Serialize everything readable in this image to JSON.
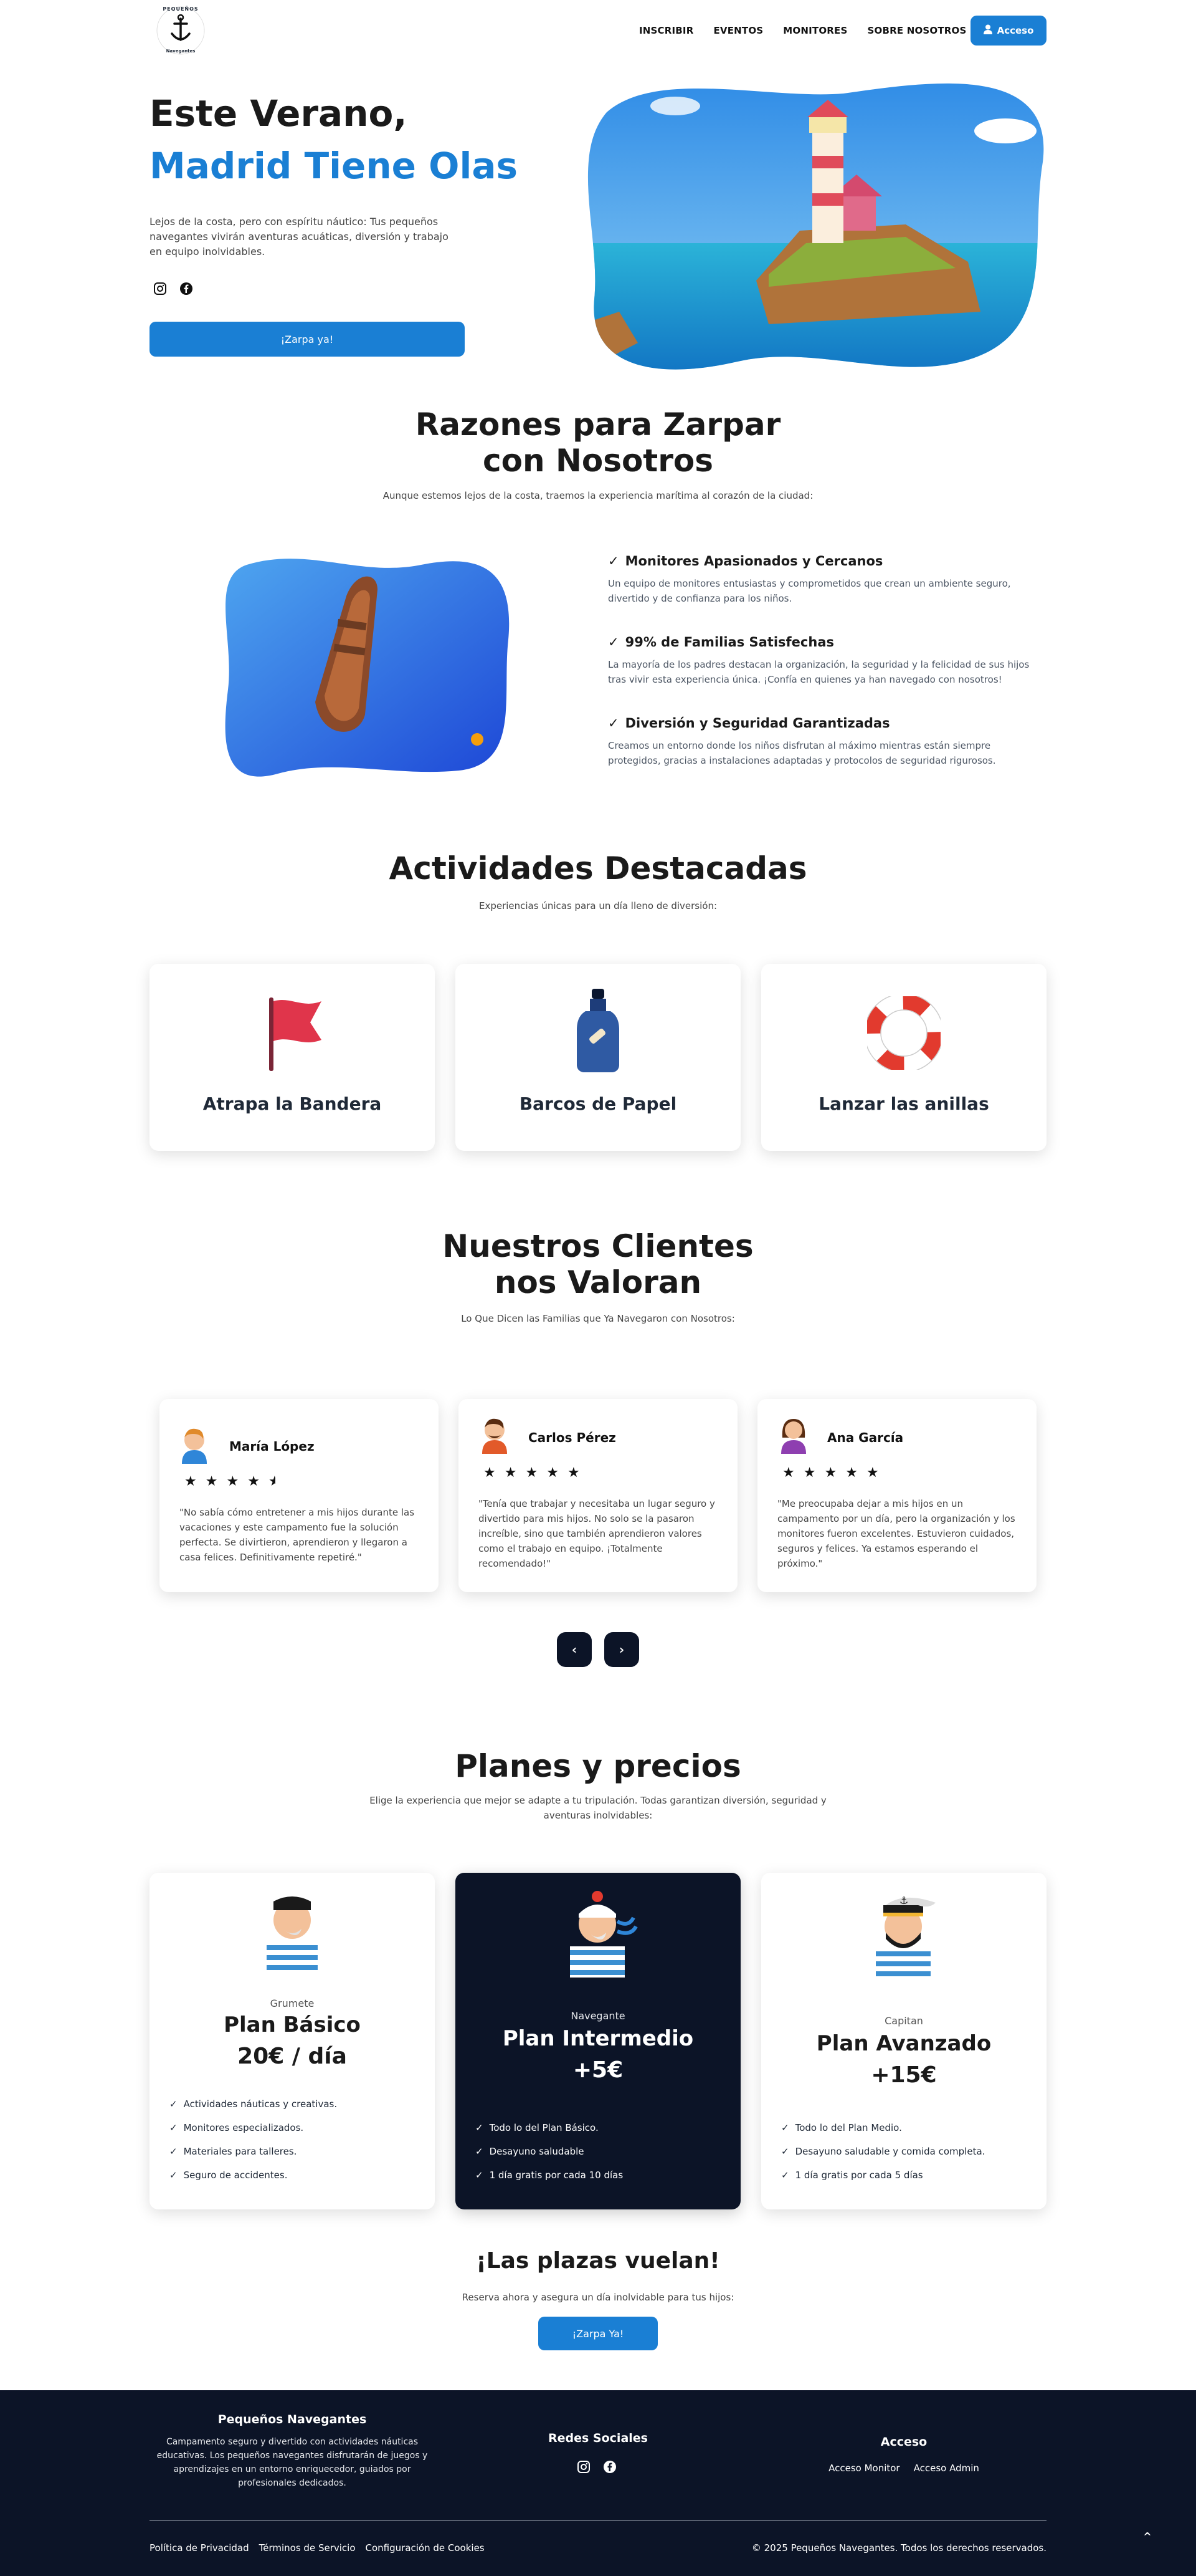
{
  "header": {
    "logo_text_top": "PEQUEÑOS",
    "logo_text_bottom": "Navegantes",
    "nav": [
      "INSCRIBIR",
      "EVENTOS",
      "MONITORES",
      "SOBRE NOSOTROS"
    ],
    "login_label": "Acceso"
  },
  "hero": {
    "title_line1": "Este Verano,",
    "title_line2": "Madrid Tiene Olas",
    "description": "Lejos de la costa, pero con espíritu náutico: Tus pequeños navegantes vivirán aventuras acuáticas, diversión y trabajo en equipo inolvidables.",
    "cta": "¡Zarpa ya!"
  },
  "reasons": {
    "title": "Razones para Zarpar con Nosotros",
    "subtitle": "Aunque estemos lejos de la costa, traemos la experiencia marítima al corazón de la ciudad:",
    "items": [
      {
        "title": "Monitores Apasionados y Cercanos",
        "text": "Un equipo de monitores entusiastas y comprometidos que crean un ambiente seguro, divertido y de confianza para los niños."
      },
      {
        "title": "99% de Familias Satisfechas",
        "text": "La mayoría de los padres destacan la organización, la seguridad y la felicidad de sus hijos tras vivir esta experiencia única. ¡Confía en quienes ya han navegado con nosotros!"
      },
      {
        "title": "Diversión y Seguridad Garantizadas",
        "text": "Creamos un entorno donde los niños disfrutan al máximo mientras están siempre protegidos, gracias a instalaciones adaptadas y protocolos de seguridad rigurosos."
      }
    ]
  },
  "activities": {
    "title": "Actividades Destacadas",
    "subtitle": "Experiencias únicas para un día lleno de diversión:",
    "items": [
      "Atrapa la Bandera",
      "Barcos de Papel",
      "Lanzar las anillas"
    ]
  },
  "reviews": {
    "title": "Nuestros Clientes nos Valoran",
    "subtitle": "Lo Que Dicen las Familias que Ya Navegaron con Nosotros:",
    "items": [
      {
        "name": "María López",
        "rating": 4.5,
        "text": "\"No sabía cómo entretener a mis hijos durante las vacaciones y este campamento fue la solución perfecta. Se divirtieron, aprendieron y llegaron a casa felices. Definitivamente repetiré.\""
      },
      {
        "name": "Carlos Pérez",
        "rating": 5,
        "text": "\"Tenía que trabajar y necesitaba un lugar seguro y divertido para mis hijos. No solo se la pasaron increíble, sino que también aprendieron valores como el trabajo en equipo. ¡Totalmente recomendado!\""
      },
      {
        "name": "Ana García",
        "rating": 5,
        "text": "\"Me preocupaba dejar a mis hijos en un campamento por un día, pero la organización y los monitores fueron excelentes. Estuvieron cuidados, seguros y felices. Ya estamos esperando el próximo.\""
      }
    ],
    "prev": "‹",
    "next": "›"
  },
  "plans": {
    "title": "Planes y precios",
    "subtitle": "Elige la experiencia que mejor se adapte a tu tripulación. Todas garantizan diversión, seguridad y aventuras inolvidables:",
    "items": [
      {
        "rank": "Grumete",
        "name": "Plan Básico",
        "price": "20€ / día",
        "features": [
          "Actividades náuticas y creativas.",
          "Monitores especializados.",
          "Materiales para talleres.",
          "Seguro de accidentes."
        ]
      },
      {
        "rank": "Navegante",
        "name": "Plan Intermedio",
        "price": "+5€",
        "features": [
          "Todo lo del Plan Básico.",
          "Desayuno saludable",
          "1 día gratis por cada 10 días"
        ]
      },
      {
        "rank": "Capitan",
        "name": "Plan Avanzado",
        "price": "+15€",
        "features": [
          "Todo lo del Plan Medio.",
          "Desayuno saludable y comida completa.",
          "1 día gratis por cada 5 días"
        ]
      }
    ]
  },
  "cta_section": {
    "title": "¡Las plazas vuelan!",
    "subtitle": "Reserva ahora y asegura un día inolvidable para tus hijos:",
    "button": "¡Zarpa Ya!"
  },
  "footer": {
    "brand_title": "Pequeños Navegantes",
    "brand_text": "Campamento seguro y divertido con actividades náuticas educativas. Los pequeños navegantes disfrutarán de juegos y aprendizajes en un entorno enriquecedor, guiados por profesionales dedicados.",
    "social_title": "Redes Sociales",
    "access_title": "Acceso",
    "access_links": [
      "Acceso Monitor",
      "Acceso Admin"
    ],
    "legal_links": [
      "Política de Privacidad",
      "Términos de Servicio",
      "Configuración de Cookies"
    ],
    "copyright": "© 2025 Pequeños Navegantes. Todos los derechos reservados.",
    "scroll_top": "^"
  },
  "colors": {
    "accent": "#1a7fd4",
    "dark": "#0c1427"
  }
}
